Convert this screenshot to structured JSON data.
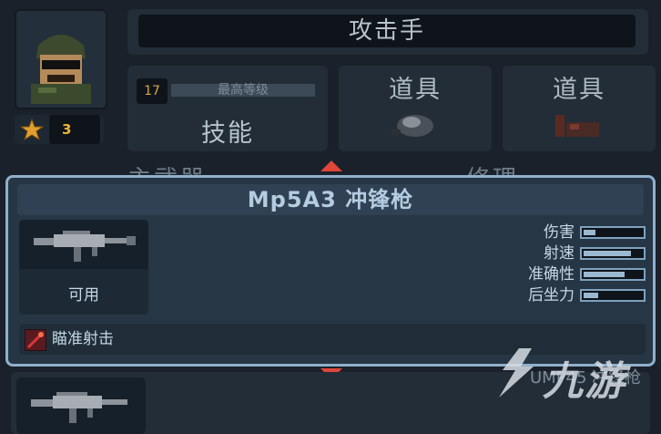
{
  "character": {
    "name": "攻击手",
    "stars": "3",
    "level": "17",
    "level_caption": "最高等级",
    "skill_label": "技能"
  },
  "items": [
    {
      "label": "道具"
    },
    {
      "label": "道具"
    }
  ],
  "section_headers": {
    "primary_weapon": "主武器",
    "upgrade": "修理"
  },
  "weapon_card": {
    "title": "Mp5A3 冲锋枪",
    "availability": "可用",
    "stats": [
      {
        "label": "伤害",
        "value": 0.2
      },
      {
        "label": "射速",
        "value": 0.82
      },
      {
        "label": "准确性",
        "value": 0.7
      },
      {
        "label": "后坐力",
        "value": 0.25
      }
    ],
    "ability": "瞄准射击"
  },
  "next_weapon": {
    "title_partial": "UMP45 冲锋枪"
  },
  "watermark": {
    "text": "九游"
  },
  "colors": {
    "card_border": "#8fb0cc",
    "arrow": "#e0463a",
    "star": "#f0b434",
    "level": "#d8a645"
  }
}
